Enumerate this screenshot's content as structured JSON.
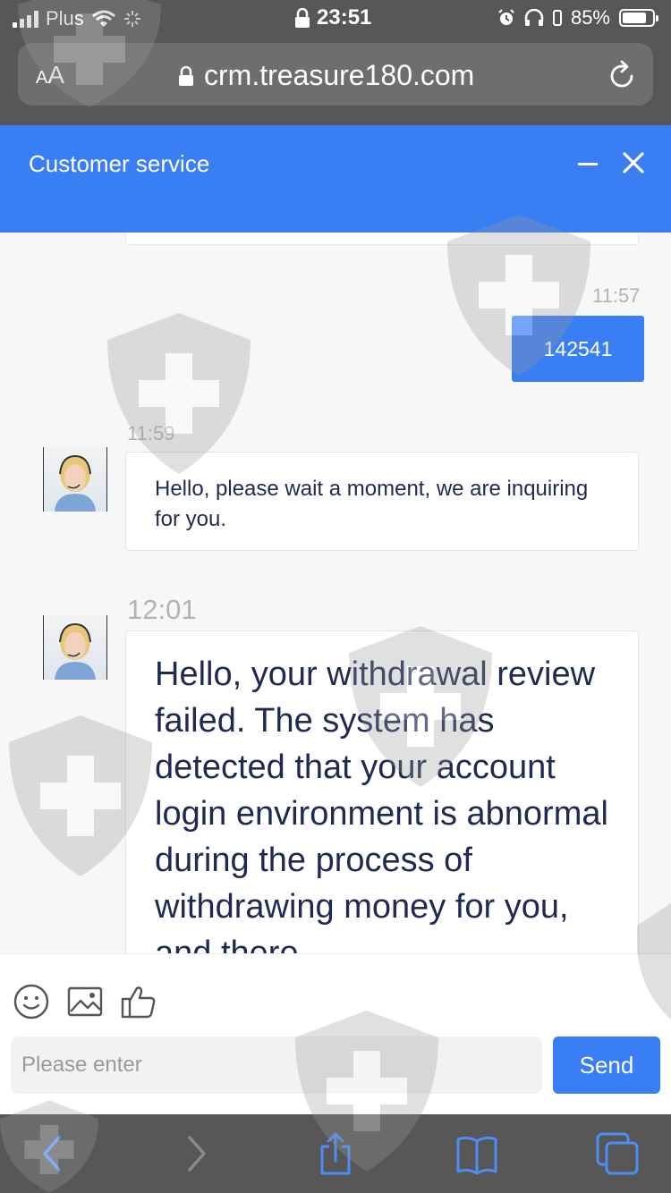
{
  "status_bar": {
    "carrier": "Plus",
    "time": "23:51",
    "battery": "85%",
    "icons": [
      "signal-icon",
      "wifi-icon",
      "loading-icon",
      "lock-icon",
      "alarm-icon",
      "headphones-icon",
      "battery-icon"
    ]
  },
  "browser": {
    "text_size_label": "AA",
    "url": "crm.treasure180.com",
    "icons": [
      "lock-icon",
      "reload-icon"
    ]
  },
  "chat": {
    "title": "Customer service",
    "icons": [
      "minimize-icon",
      "close-icon"
    ],
    "messages": [
      {
        "time": "11:57",
        "direction": "outgoing",
        "text": "142541"
      },
      {
        "time": "11:59",
        "direction": "incoming",
        "text": "Hello, please wait a moment, we are inquiring for you."
      },
      {
        "time": "12:01",
        "direction": "incoming",
        "text": "Hello, your withdrawal review failed. The system has detected that your account login environment is abnormal during the process of withdrawing money for you, and there"
      }
    ]
  },
  "composer": {
    "placeholder": "Please enter",
    "send_label": "Send",
    "tools": [
      "emoji-icon",
      "image-icon",
      "thumbs-up-icon"
    ]
  },
  "safari_toolbar": {
    "icons": [
      "back-icon",
      "forward-icon",
      "share-icon",
      "bookmarks-icon",
      "tabs-icon"
    ]
  },
  "colors": {
    "accent": "#3a7ef4",
    "browser_chrome": "#575757",
    "message_text": "#1f2a52",
    "timestamp": "#b3b3b3"
  }
}
